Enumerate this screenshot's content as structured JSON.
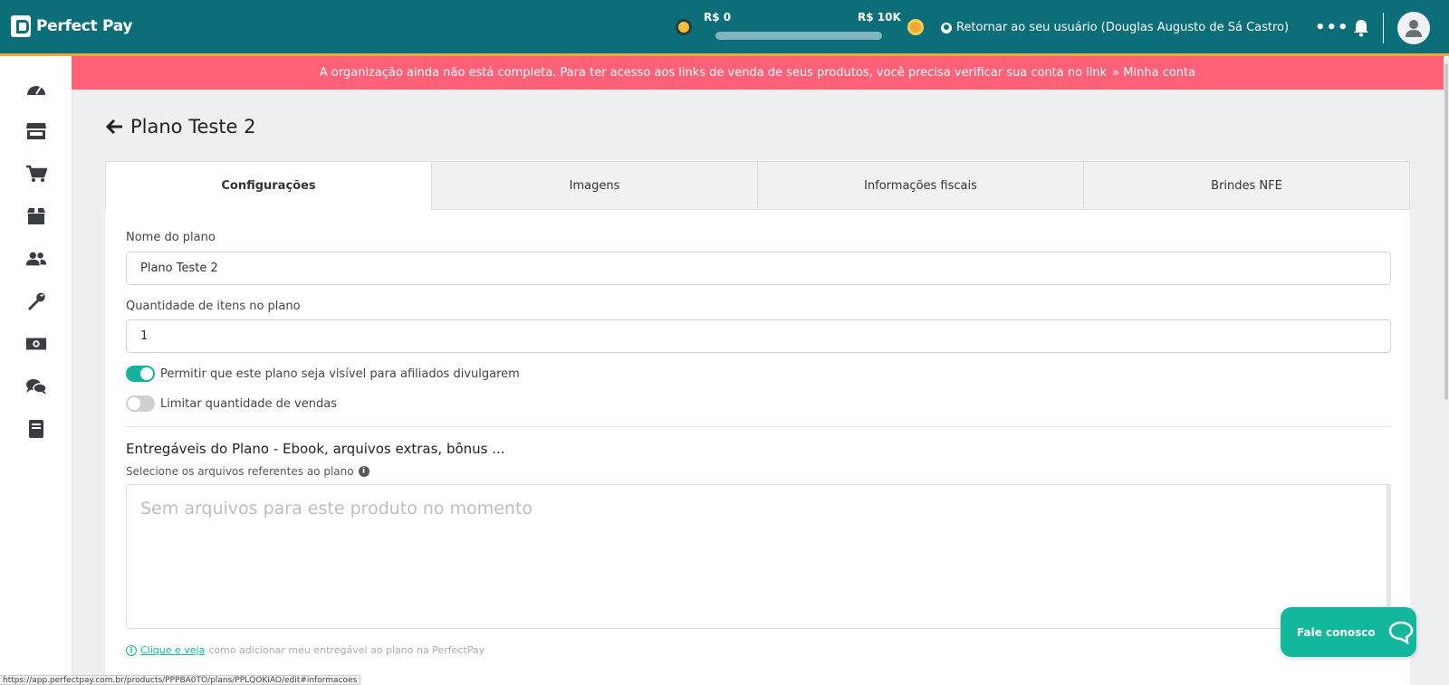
{
  "brand": {
    "name": "Perfect Pay"
  },
  "header": {
    "goal_min": "R$ 0",
    "goal_max": "R$ 10K",
    "goal_progress": 0,
    "return_user_label": "Retornar ao seu usuário (Douglas Augusto de Sá Castro)",
    "more_label": "•••"
  },
  "sidebar": {
    "items": [
      {
        "name": "dashboard",
        "icon": "speedometer-icon"
      },
      {
        "name": "store",
        "icon": "store-icon"
      },
      {
        "name": "cart",
        "icon": "cart-icon"
      },
      {
        "name": "products",
        "icon": "box-icon"
      },
      {
        "name": "users",
        "icon": "users-icon"
      },
      {
        "name": "tools",
        "icon": "wrench-icon"
      },
      {
        "name": "finance",
        "icon": "money-icon"
      },
      {
        "name": "chat",
        "icon": "chat-icon"
      },
      {
        "name": "docs",
        "icon": "book-icon"
      }
    ]
  },
  "alert": {
    "text": "A organização ainda não está completa. Para ter acesso aos links de venda de seus produtos, você precisa verificar sua conta no link",
    "link": "» Minha conta"
  },
  "page": {
    "title": "Plano Teste 2"
  },
  "tabs": [
    {
      "label": "Configurações",
      "active": true
    },
    {
      "label": "Imagens",
      "active": false
    },
    {
      "label": "Informações fiscais",
      "active": false
    },
    {
      "label": "Brindes NFE",
      "active": false
    }
  ],
  "form": {
    "plan_name_label": "Nome do plano",
    "plan_name_value": "Plano Teste 2",
    "quantity_label": "Quantidade de itens no plano",
    "quantity_value": "1",
    "affiliate_toggle_label": "Permitir que este plano seja visível para afiliados divulgarem",
    "affiliate_toggle_on": true,
    "limit_toggle_label": "Limitar quantidade de vendas",
    "limit_toggle_on": false,
    "deliverables_title": "Entregáveis do Plano - Ebook, arquivos extras, bônus ...",
    "files_label": "Selecione os arquivos referentes ao plano",
    "files_empty": "Sem arquivos para este produto no momento",
    "help_link": "Clique e veja",
    "help_text": "como adicionar meu entregável ao plano na PerfectPay"
  },
  "contact": {
    "label": "Fale conosco"
  },
  "status_url": "https://app.perfectpay.com.br/products/PPPBA0TO/plans/PPLQOKIAO/edit#informacoes",
  "colors": {
    "primary": "#0b6e78",
    "accent": "#15b39c",
    "alert": "#ff6179",
    "goal": "#f0a63a"
  }
}
